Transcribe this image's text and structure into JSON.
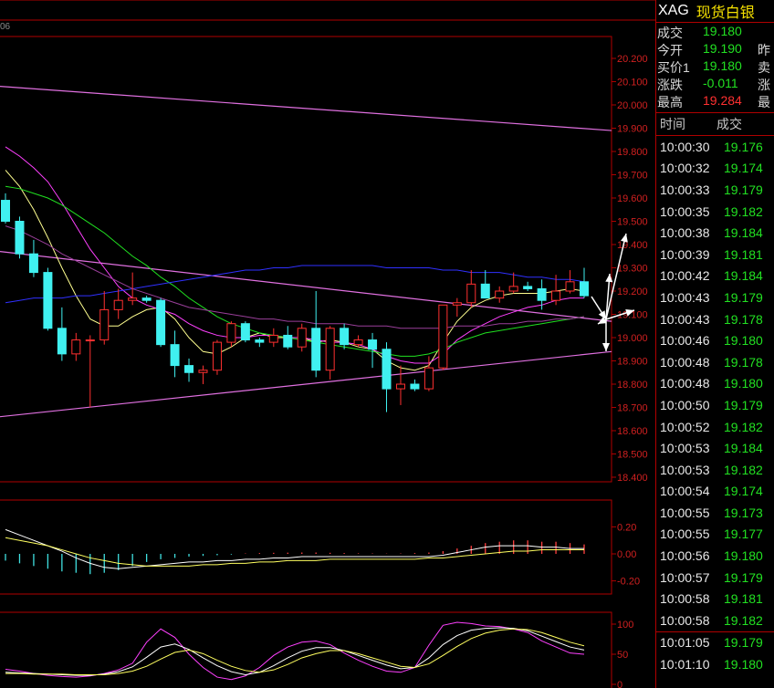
{
  "chart_data": [
    {
      "type": "candlestick",
      "title": "",
      "y_ticks": [
        "20.200",
        "20.100",
        "20.000",
        "19.900",
        "19.800",
        "19.700",
        "19.600",
        "19.500",
        "19.400",
        "19.300",
        "19.200",
        "19.100",
        "19.000",
        "18.900",
        "18.800",
        "18.700",
        "18.600",
        "18.500",
        "18.400"
      ],
      "ylim": [
        18.4,
        20.2
      ],
      "candles": [
        {
          "o": 19.59,
          "h": 19.62,
          "l": 19.49,
          "c": 19.5
        },
        {
          "o": 19.5,
          "h": 19.52,
          "l": 19.34,
          "c": 19.36
        },
        {
          "o": 19.36,
          "h": 19.42,
          "l": 19.26,
          "c": 19.28
        },
        {
          "o": 19.28,
          "h": 19.3,
          "l": 19.03,
          "c": 19.04
        },
        {
          "o": 19.04,
          "h": 19.13,
          "l": 18.9,
          "c": 18.93
        },
        {
          "o": 18.93,
          "h": 19.02,
          "l": 18.9,
          "c": 18.99
        },
        {
          "o": 18.99,
          "h": 19.01,
          "l": 18.7,
          "c": 18.99
        },
        {
          "o": 18.99,
          "h": 19.2,
          "l": 18.97,
          "c": 19.12
        },
        {
          "o": 19.12,
          "h": 19.21,
          "l": 19.08,
          "c": 19.16
        },
        {
          "o": 19.16,
          "h": 19.28,
          "l": 19.14,
          "c": 19.17
        },
        {
          "o": 19.17,
          "h": 19.18,
          "l": 19.15,
          "c": 19.16
        },
        {
          "o": 19.16,
          "h": 19.17,
          "l": 18.96,
          "c": 18.97
        },
        {
          "o": 18.97,
          "h": 19.03,
          "l": 18.83,
          "c": 18.88
        },
        {
          "o": 18.88,
          "h": 18.91,
          "l": 18.81,
          "c": 18.85
        },
        {
          "o": 18.85,
          "h": 18.88,
          "l": 18.8,
          "c": 18.86
        },
        {
          "o": 18.86,
          "h": 18.99,
          "l": 18.84,
          "c": 18.98
        },
        {
          "o": 18.98,
          "h": 19.07,
          "l": 18.96,
          "c": 19.06
        },
        {
          "o": 19.06,
          "h": 19.07,
          "l": 18.98,
          "c": 18.99
        },
        {
          "o": 18.99,
          "h": 19.0,
          "l": 18.96,
          "c": 18.98
        },
        {
          "o": 18.98,
          "h": 19.04,
          "l": 18.96,
          "c": 19.01
        },
        {
          "o": 19.01,
          "h": 19.05,
          "l": 18.95,
          "c": 18.96
        },
        {
          "o": 18.96,
          "h": 19.06,
          "l": 18.94,
          "c": 19.04
        },
        {
          "o": 19.04,
          "h": 19.2,
          "l": 18.83,
          "c": 18.86
        },
        {
          "o": 18.86,
          "h": 19.05,
          "l": 18.82,
          "c": 19.04
        },
        {
          "o": 19.04,
          "h": 19.06,
          "l": 18.95,
          "c": 18.97
        },
        {
          "o": 18.97,
          "h": 19.01,
          "l": 18.96,
          "c": 18.99
        },
        {
          "o": 18.99,
          "h": 19.02,
          "l": 18.87,
          "c": 18.95
        },
        {
          "o": 18.95,
          "h": 18.98,
          "l": 18.68,
          "c": 18.78
        },
        {
          "o": 18.78,
          "h": 18.88,
          "l": 18.71,
          "c": 18.8
        },
        {
          "o": 18.8,
          "h": 18.82,
          "l": 18.77,
          "c": 18.78
        },
        {
          "o": 18.78,
          "h": 18.92,
          "l": 18.77,
          "c": 18.87
        },
        {
          "o": 18.87,
          "h": 19.14,
          "l": 18.86,
          "c": 19.14
        },
        {
          "o": 19.14,
          "h": 19.17,
          "l": 19.09,
          "c": 19.15
        },
        {
          "o": 19.15,
          "h": 19.29,
          "l": 19.13,
          "c": 19.23
        },
        {
          "o": 19.23,
          "h": 19.29,
          "l": 19.18,
          "c": 19.17
        },
        {
          "o": 19.17,
          "h": 19.22,
          "l": 19.15,
          "c": 19.2
        },
        {
          "o": 19.2,
          "h": 19.28,
          "l": 19.19,
          "c": 19.22
        },
        {
          "o": 19.22,
          "h": 19.24,
          "l": 19.2,
          "c": 19.21
        },
        {
          "o": 19.21,
          "h": 19.25,
          "l": 19.12,
          "c": 19.16
        },
        {
          "o": 19.16,
          "h": 19.27,
          "l": 19.14,
          "c": 19.2
        },
        {
          "o": 19.2,
          "h": 19.29,
          "l": 19.19,
          "c": 19.24
        },
        {
          "o": 19.24,
          "h": 19.3,
          "l": 19.17,
          "c": 19.18
        }
      ],
      "ma_series": [
        {
          "color": "#ffff90",
          "values": [
            19.72,
            19.65,
            19.55,
            19.43,
            19.3,
            19.18,
            19.08,
            19.05,
            19.05,
            19.09,
            19.12,
            19.13,
            19.08,
            19.0,
            18.94,
            18.93,
            18.96,
            19.0,
            19.02,
            19.0,
            19.0,
            19.0,
            18.98,
            18.99,
            18.98,
            18.96,
            18.95,
            18.9,
            18.87,
            18.86,
            18.88,
            18.98,
            19.07,
            19.13,
            19.16,
            19.18,
            19.19,
            19.19,
            19.19,
            19.2,
            19.21,
            19.2
          ]
        },
        {
          "color": "#ff40ff",
          "values": [
            19.82,
            19.78,
            19.73,
            19.67,
            19.58,
            19.48,
            19.38,
            19.3,
            19.22,
            19.17,
            19.14,
            19.12,
            19.1,
            19.06,
            19.03,
            19.01,
            19.0,
            19.0,
            19.01,
            19.01,
            19.0,
            19.0,
            18.99,
            18.98,
            18.98,
            18.97,
            18.95,
            18.92,
            18.9,
            18.89,
            18.89,
            18.93,
            18.99,
            19.03,
            19.06,
            19.09,
            19.11,
            19.13,
            19.14,
            19.16,
            19.17,
            19.17
          ]
        },
        {
          "color": "#20e020",
          "values": [
            19.65,
            19.64,
            19.62,
            19.6,
            19.57,
            19.53,
            19.49,
            19.45,
            19.4,
            19.35,
            19.31,
            19.26,
            19.22,
            19.17,
            19.13,
            19.09,
            19.06,
            19.04,
            19.02,
            19.01,
            19.0,
            18.99,
            18.98,
            18.97,
            18.96,
            18.95,
            18.94,
            18.93,
            18.92,
            18.92,
            18.93,
            18.95,
            18.98,
            19.0,
            19.02,
            19.03,
            19.04,
            19.05,
            19.06,
            19.07,
            19.08,
            19.09
          ]
        },
        {
          "color": "#3030ff",
          "values": [
            19.15,
            19.16,
            19.17,
            19.17,
            19.17,
            19.18,
            19.18,
            19.19,
            19.2,
            19.21,
            19.22,
            19.23,
            19.24,
            19.25,
            19.26,
            19.27,
            19.28,
            19.29,
            19.29,
            19.3,
            19.3,
            19.31,
            19.31,
            19.31,
            19.31,
            19.31,
            19.31,
            19.3,
            19.3,
            19.3,
            19.3,
            19.29,
            19.29,
            19.28,
            19.28,
            19.28,
            19.27,
            19.26,
            19.26,
            19.25,
            19.25,
            19.24
          ]
        },
        {
          "color": "#9a3f9a",
          "values": [
            19.48,
            19.46,
            19.43,
            19.4,
            19.36,
            19.33,
            19.3,
            19.27,
            19.24,
            19.21,
            19.19,
            19.17,
            19.15,
            19.13,
            19.12,
            19.11,
            19.1,
            19.09,
            19.08,
            19.08,
            19.07,
            19.07,
            19.06,
            19.06,
            19.06,
            19.05,
            19.05,
            19.05,
            19.04,
            19.04,
            19.04,
            19.04,
            19.05,
            19.05,
            19.05,
            19.06,
            19.06,
            19.07,
            19.07,
            19.08,
            19.08,
            19.09
          ]
        }
      ],
      "trend_lines": [
        {
          "color": "#e070e0",
          "from": [
            0,
            20.08
          ],
          "to": [
            1,
            19.89
          ]
        },
        {
          "color": "#e070e0",
          "from": [
            0,
            19.37
          ],
          "to": [
            1,
            19.07
          ]
        },
        {
          "color": "#e070e0",
          "from": [
            0,
            18.66
          ],
          "to": [
            1,
            18.94
          ]
        }
      ]
    },
    {
      "type": "bar",
      "title": "",
      "y_ticks": [
        "0.20",
        "0.00",
        "-0.20"
      ],
      "ylim": [
        -0.25,
        0.25
      ],
      "values": [
        -0.05,
        -0.07,
        -0.09,
        -0.11,
        -0.13,
        -0.14,
        -0.15,
        -0.14,
        -0.12,
        -0.09,
        -0.06,
        -0.04,
        -0.03,
        -0.02,
        -0.015,
        -0.01,
        -0.005,
        0.003,
        0.006,
        0.008,
        0.009,
        0.01,
        0.01,
        0.008,
        0.006,
        0.004,
        0.003,
        0.002,
        0.003,
        0.006,
        0.01,
        0.02,
        0.04,
        0.06,
        0.08,
        0.09,
        0.1,
        0.1,
        0.09,
        0.09,
        0.08,
        0.07
      ],
      "line1": [
        0.18,
        0.14,
        0.1,
        0.06,
        0.02,
        -0.03,
        -0.07,
        -0.1,
        -0.11,
        -0.1,
        -0.09,
        -0.08,
        -0.07,
        -0.06,
        -0.06,
        -0.05,
        -0.05,
        -0.04,
        -0.04,
        -0.03,
        -0.03,
        -0.02,
        -0.02,
        -0.02,
        -0.02,
        -0.02,
        -0.02,
        -0.02,
        -0.02,
        -0.02,
        -0.02,
        -0.01,
        0.01,
        0.03,
        0.05,
        0.06,
        0.06,
        0.06,
        0.05,
        0.05,
        0.04,
        0.04
      ],
      "line2": [
        0.12,
        0.1,
        0.08,
        0.06,
        0.03,
        0.0,
        -0.03,
        -0.05,
        -0.07,
        -0.08,
        -0.09,
        -0.09,
        -0.09,
        -0.09,
        -0.08,
        -0.08,
        -0.07,
        -0.07,
        -0.06,
        -0.06,
        -0.05,
        -0.05,
        -0.05,
        -0.04,
        -0.04,
        -0.04,
        -0.04,
        -0.04,
        -0.04,
        -0.04,
        -0.03,
        -0.03,
        -0.02,
        -0.01,
        0.0,
        0.01,
        0.02,
        0.02,
        0.03,
        0.03,
        0.03,
        0.03
      ]
    },
    {
      "type": "line",
      "title": "",
      "y_ticks": [
        "100",
        "50",
        "0"
      ],
      "ylim": [
        0,
        100
      ],
      "series": [
        {
          "color": "#ff40ff",
          "values": [
            25,
            22,
            18,
            15,
            13,
            12,
            14,
            18,
            24,
            35,
            70,
            92,
            78,
            50,
            28,
            12,
            8,
            14,
            28,
            48,
            62,
            70,
            72,
            66,
            52,
            40,
            30,
            22,
            20,
            28,
            65,
            98,
            103,
            101,
            97,
            96,
            92,
            86,
            72,
            62,
            52,
            50
          ]
        },
        {
          "color": "#ffffff",
          "values": [
            20,
            19,
            18,
            17,
            16,
            15,
            15,
            17,
            21,
            29,
            45,
            62,
            67,
            58,
            44,
            31,
            21,
            16,
            20,
            31,
            44,
            55,
            61,
            61,
            56,
            48,
            40,
            32,
            26,
            28,
            44,
            66,
            81,
            90,
            93,
            94,
            93,
            89,
            80,
            71,
            62,
            57
          ]
        },
        {
          "color": "#ffff60",
          "values": [
            18,
            18,
            17,
            17,
            17,
            16,
            16,
            16,
            18,
            22,
            30,
            42,
            53,
            57,
            51,
            40,
            30,
            23,
            20,
            24,
            33,
            44,
            51,
            56,
            56,
            51,
            44,
            37,
            30,
            28,
            34,
            48,
            63,
            76,
            85,
            90,
            92,
            91,
            86,
            78,
            70,
            64
          ]
        }
      ]
    }
  ],
  "corner_label": "06",
  "header": {
    "code": "XAG",
    "name": "现货白银"
  },
  "quote": [
    {
      "label": "成交",
      "value": "19.180",
      "cls": "green",
      "extra": ""
    },
    {
      "label": "今开",
      "value": "19.190",
      "cls": "green",
      "extra": "昨"
    },
    {
      "label": "买价1",
      "value": "19.180",
      "cls": "green",
      "extra": "卖"
    },
    {
      "label": "涨跌",
      "value": "-0.011",
      "cls": "green",
      "extra": "涨"
    },
    {
      "label": "最高",
      "value": "19.284",
      "cls": "red",
      "extra": "最"
    }
  ],
  "ticks_header": {
    "time": "时间",
    "price": "成交"
  },
  "ticks": [
    {
      "time": "10:00:30",
      "price": "19.176"
    },
    {
      "time": "10:00:32",
      "price": "19.174"
    },
    {
      "time": "10:00:33",
      "price": "19.179"
    },
    {
      "time": "10:00:35",
      "price": "19.182"
    },
    {
      "time": "10:00:38",
      "price": "19.184"
    },
    {
      "time": "10:00:39",
      "price": "19.181"
    },
    {
      "time": "10:00:42",
      "price": "19.184"
    },
    {
      "time": "10:00:43",
      "price": "19.179"
    },
    {
      "time": "10:00:43",
      "price": "19.178"
    },
    {
      "time": "10:00:46",
      "price": "19.180"
    },
    {
      "time": "10:00:48",
      "price": "19.178"
    },
    {
      "time": "10:00:48",
      "price": "19.180"
    },
    {
      "time": "10:00:50",
      "price": "19.179"
    },
    {
      "time": "10:00:52",
      "price": "19.182"
    },
    {
      "time": "10:00:53",
      "price": "19.184"
    },
    {
      "time": "10:00:53",
      "price": "19.182"
    },
    {
      "time": "10:00:54",
      "price": "19.174"
    },
    {
      "time": "10:00:55",
      "price": "19.173"
    },
    {
      "time": "10:00:55",
      "price": "19.177"
    },
    {
      "time": "10:00:56",
      "price": "19.180"
    },
    {
      "time": "10:00:57",
      "price": "19.179"
    },
    {
      "time": "10:00:58",
      "price": "19.181"
    },
    {
      "time": "10:00:58",
      "price": "19.182"
    }
  ],
  "ticks2": [
    {
      "time": "10:01:05",
      "price": "19.179"
    },
    {
      "time": "10:01:10",
      "price": "19.180"
    }
  ]
}
